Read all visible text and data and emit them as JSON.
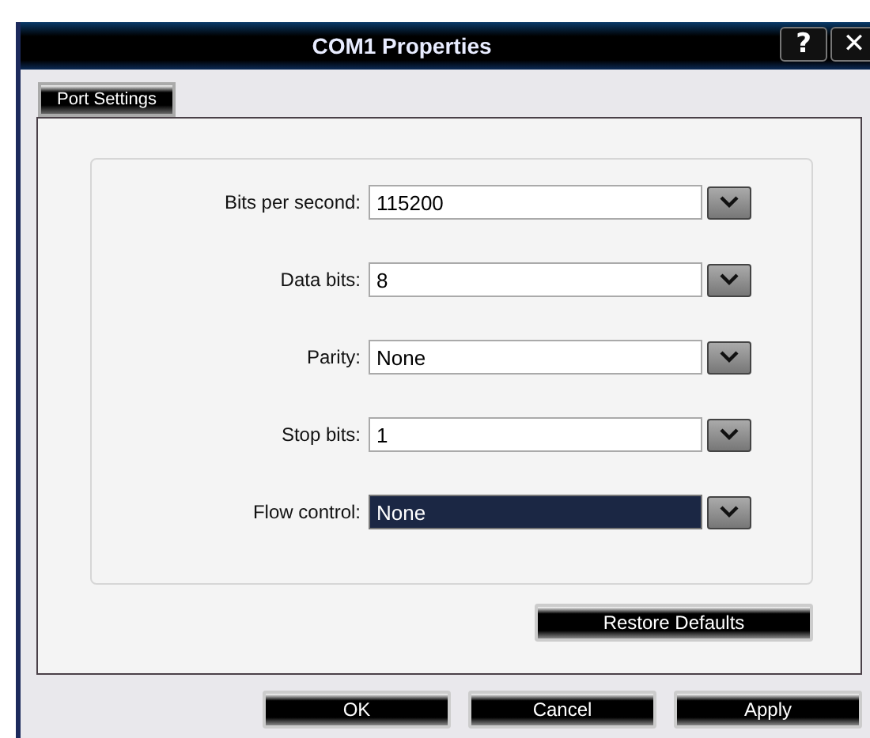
{
  "window": {
    "title": "COM1 Properties",
    "title_buttons": [
      "?",
      "✕"
    ]
  },
  "tabs": [
    {
      "label": "Port Settings",
      "selected": true
    }
  ],
  "fields": [
    {
      "label": "Bits per second:",
      "value": "115200",
      "focused": false
    },
    {
      "label": "Data bits:",
      "value": "8",
      "focused": false
    },
    {
      "label": "Parity:",
      "value": "None",
      "focused": false
    },
    {
      "label": "Stop bits:",
      "value": "1",
      "focused": false
    },
    {
      "label": "Flow control:",
      "value": "None",
      "focused": true
    }
  ],
  "panel_buttons": [
    "Restore Defaults"
  ],
  "buttons": [
    "OK",
    "Cancel",
    "Apply"
  ]
}
